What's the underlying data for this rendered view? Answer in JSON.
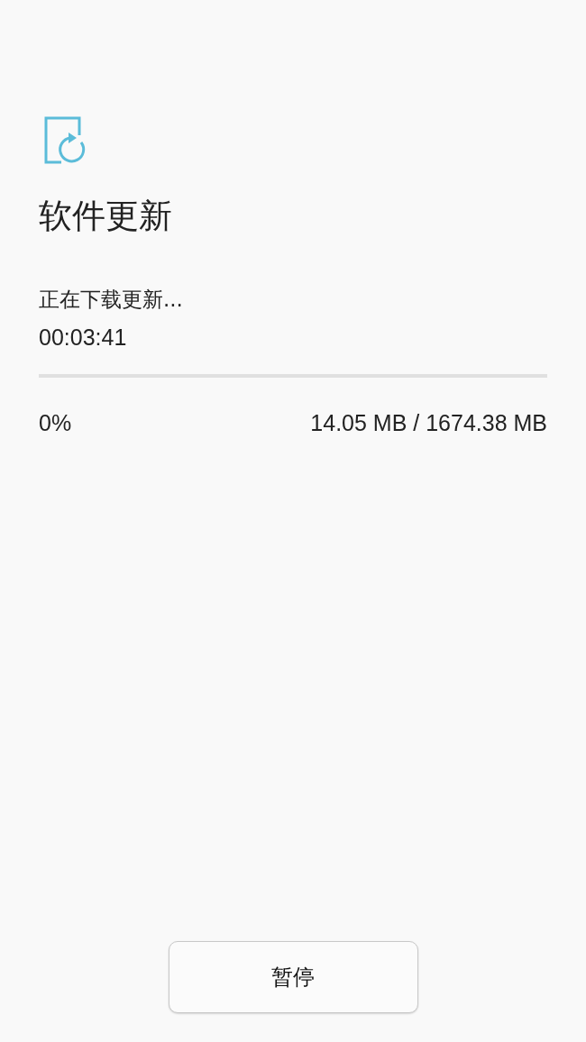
{
  "title": "软件更新",
  "status": "正在下载更新...",
  "elapsed": "00:03:41",
  "progress": {
    "level": 0,
    "percent": "0%",
    "size": "14.05 MB / 1674.38 MB"
  },
  "buttons": [
    {
      "label": "暂停"
    }
  ]
}
